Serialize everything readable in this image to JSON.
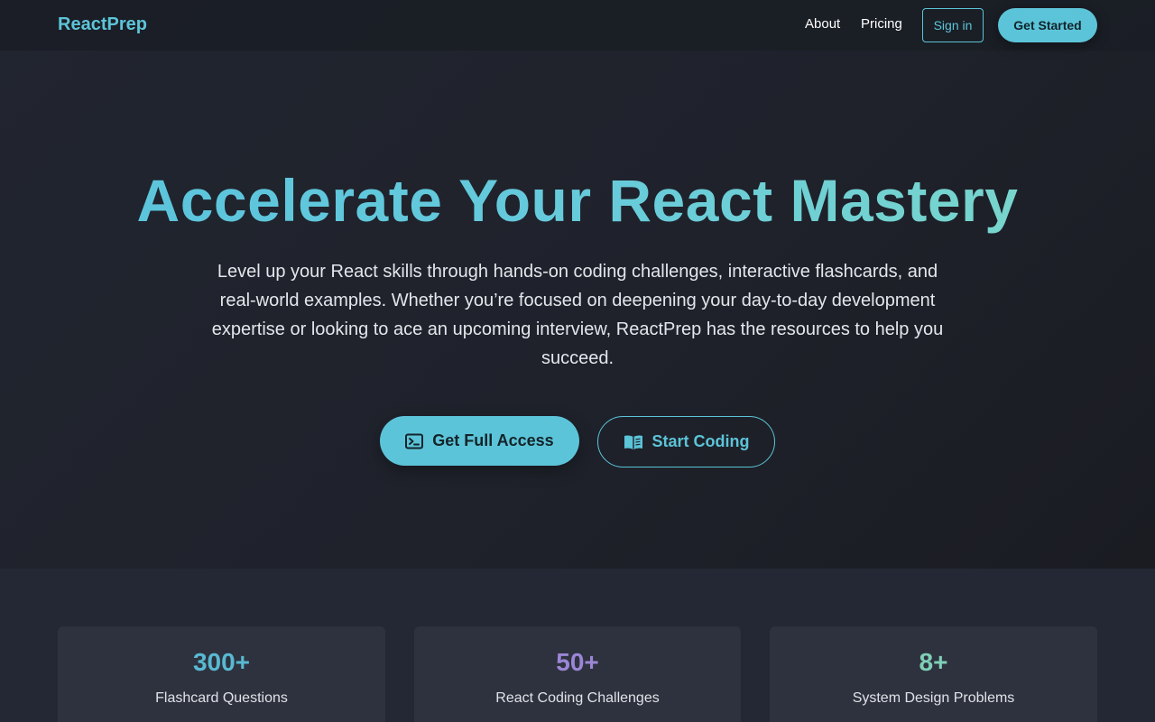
{
  "nav": {
    "brand": "ReactPrep",
    "links": [
      "About",
      "Pricing"
    ],
    "sign_in": "Sign in",
    "get_started": "Get Started"
  },
  "hero": {
    "title": "Accelerate Your React Mastery",
    "subtitle": "Level up your React skills through hands-on coding challenges, interactive flashcards, and real-world examples. Whether you’re focused on deepening your day-to-day development expertise or looking to ace an upcoming interview, ReactPrep has the resources to help you succeed.",
    "primary_cta": {
      "label": "Get Full Access",
      "icon": "terminal-icon"
    },
    "secondary_cta": {
      "label": "Start Coding",
      "icon": "book-icon"
    }
  },
  "stats": [
    {
      "value": "300+",
      "label": "Flashcard Questions",
      "color": "#58b9d2"
    },
    {
      "value": "50+",
      "label": "React Coding Challenges",
      "color": "#9b86d6"
    },
    {
      "value": "8+",
      "label": "System Design Problems",
      "color": "#7fcfb6"
    }
  ],
  "colors": {
    "accent": "#5cc4d8",
    "background": "#1d2029",
    "card": "#2e323e"
  }
}
